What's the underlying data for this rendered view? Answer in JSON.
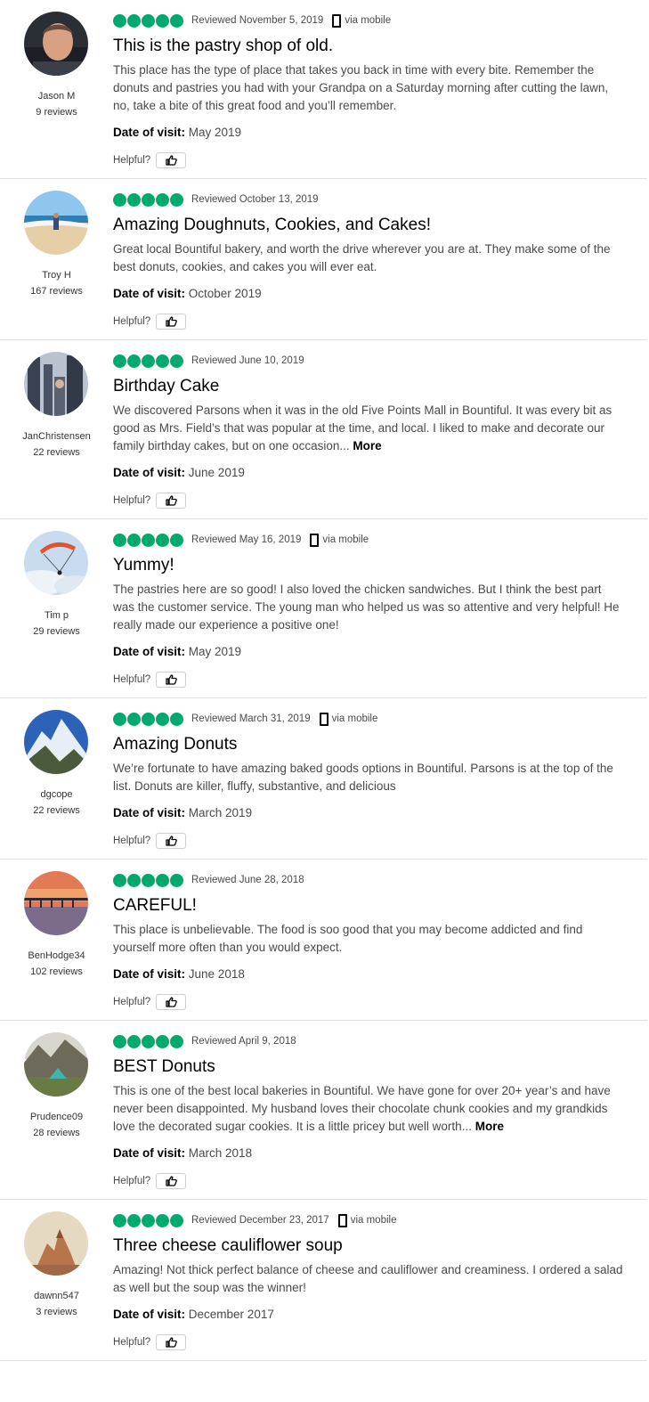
{
  "colors": {
    "bubble": "#00aa6c"
  },
  "reviews": [
    {
      "username": "Jason M",
      "review_count": "9 reviews",
      "bubbles": 5,
      "reviewed_date": "Reviewed November 5, 2019",
      "via_mobile": "via mobile",
      "title": "This is the pastry shop of old.",
      "body": "This place has the type of place that takes you back in time with every bite. Remember the donuts and pastries you had with your Grandpa on a Saturday morning after cutting the lawn, no, take a bite of this great food and you’ll remember.",
      "more": "",
      "date_of_visit_label": "Date of visit:",
      "date_of_visit": "May 2019",
      "helpful_label": "Helpful?",
      "avatar_icon": "man-portrait-icon"
    },
    {
      "username": "Troy H",
      "review_count": "167 reviews",
      "bubbles": 5,
      "reviewed_date": "Reviewed October 13, 2019",
      "via_mobile": "",
      "title": "Amazing Doughnuts, Cookies, and Cakes!",
      "body": "Great local Bountiful bakery, and worth the drive wherever you are at. They make some of the best donuts, cookies, and cakes you will ever eat.",
      "more": "",
      "date_of_visit_label": "Date of visit:",
      "date_of_visit": "October 2019",
      "helpful_label": "Helpful?",
      "avatar_icon": "beach-icon"
    },
    {
      "username": "JanChristensen",
      "review_count": "22 reviews",
      "bubbles": 5,
      "reviewed_date": "Reviewed June 10, 2019",
      "via_mobile": "",
      "title": "Birthday Cake",
      "body": "We discovered Parsons when it was in the old Five Points Mall in Bountiful. It was every bit as good as Mrs. Field’s that was popular at the time, and local. I liked to make and decorate our family birthday cakes, but on one occasion...",
      "more": "More",
      "date_of_visit_label": "Date of visit:",
      "date_of_visit": "June 2019",
      "helpful_label": "Helpful?",
      "avatar_icon": "gothic-building-icon"
    },
    {
      "username": "Tim p",
      "review_count": "29 reviews",
      "bubbles": 5,
      "reviewed_date": "Reviewed May 16, 2019",
      "via_mobile": "via mobile",
      "title": "Yummy!",
      "body": "The pastries here are so good! I also loved the chicken sandwiches. But I think the best part was the customer service. The young man who helped us was so attentive and very helpful! He really made our experience a positive one!",
      "more": "",
      "date_of_visit_label": "Date of visit:",
      "date_of_visit": "May 2019",
      "helpful_label": "Helpful?",
      "avatar_icon": "paraglider-icon"
    },
    {
      "username": "dgcope",
      "review_count": "22 reviews",
      "bubbles": 5,
      "reviewed_date": "Reviewed March 31, 2019",
      "via_mobile": "via mobile",
      "title": "Amazing Donuts",
      "body": "We’re fortunate to have amazing baked goods options in Bountiful. Parsons is at the top of the list. Donuts are killer, fluffy, substantive, and delicious",
      "more": "",
      "date_of_visit_label": "Date of visit:",
      "date_of_visit": "March 2019",
      "helpful_label": "Helpful?",
      "avatar_icon": "mountain-icon"
    },
    {
      "username": "BenHodge34",
      "review_count": "102 reviews",
      "bubbles": 5,
      "reviewed_date": "Reviewed June 28, 2018",
      "via_mobile": "",
      "title": "CAREFUL!",
      "body": "This place is unbelievable. The food is soo good that you may become addicted and find yourself more often than you would expect.",
      "more": "",
      "date_of_visit_label": "Date of visit:",
      "date_of_visit": "June 2018",
      "helpful_label": "Helpful?",
      "avatar_icon": "sunset-pier-icon"
    },
    {
      "username": "Prudence09",
      "review_count": "28 reviews",
      "bubbles": 5,
      "reviewed_date": "Reviewed April 9, 2018",
      "via_mobile": "",
      "title": "BEST Donuts",
      "body": "This is one of the best local bakeries in Bountiful. We have gone for over 20+ year’s and have never been disappointed. My husband loves their chocolate chunk cookies and my grandkids love the decorated sugar cookies. It is a little pricey but well worth...",
      "more": "More",
      "date_of_visit_label": "Date of visit:",
      "date_of_visit": "March 2018",
      "helpful_label": "Helpful?",
      "avatar_icon": "tent-icon"
    },
    {
      "username": "dawnn547",
      "review_count": "3 reviews",
      "bubbles": 5,
      "reviewed_date": "Reviewed December 23, 2017",
      "via_mobile": "via mobile",
      "title": "Three cheese cauliflower soup",
      "body": "Amazing! Not thick perfect balance of cheese and cauliflower and creaminess. I ordered a salad as well but the soup was the winner!",
      "more": "",
      "date_of_visit_label": "Date of visit:",
      "date_of_visit": "December 2017",
      "helpful_label": "Helpful?",
      "avatar_icon": "rock-formation-icon"
    }
  ]
}
